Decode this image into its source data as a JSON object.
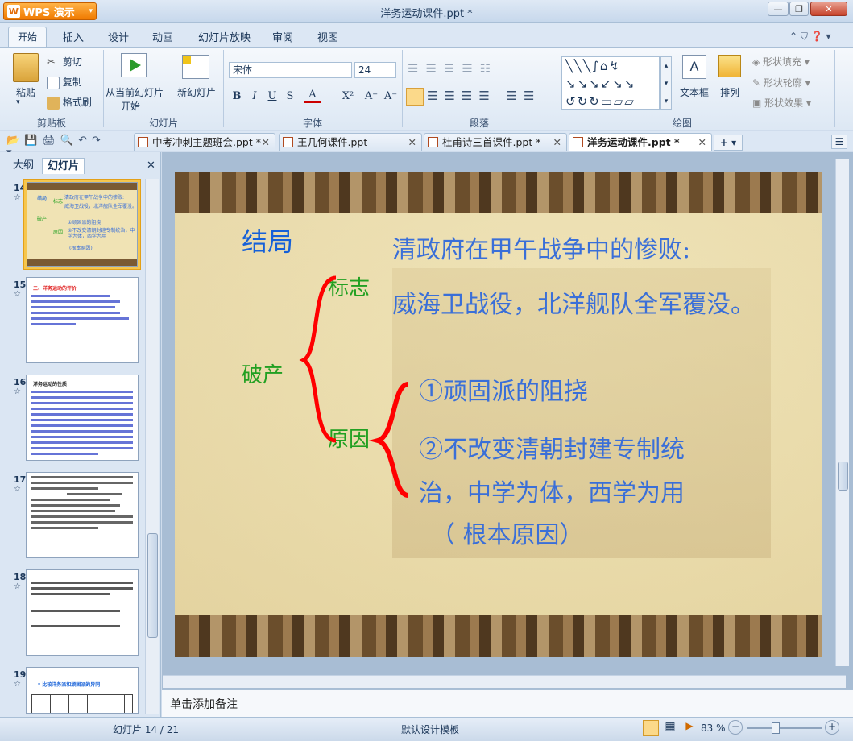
{
  "app": {
    "logo_text": "WPS 演示",
    "window_title": "洋务运动课件.ppt *"
  },
  "window_controls": {
    "minimize": "—",
    "restore": "❐",
    "close": "✕"
  },
  "ribbon_tabs": [
    "开始",
    "插入",
    "设计",
    "动画",
    "幻灯片放映",
    "审阅",
    "视图"
  ],
  "ribbon": {
    "clipboard": {
      "paste": "粘贴",
      "cut": "剪切",
      "copy": "复制",
      "format_painter": "格式刷",
      "group": "剪贴板"
    },
    "slides": {
      "from_current_line1": "从当前幻灯片",
      "from_current_line2": "开始",
      "new_slide": "新幻灯片",
      "group": "幻灯片"
    },
    "font": {
      "font_name": "宋体",
      "font_size": "24",
      "bold": "B",
      "italic": "I",
      "underline": "U",
      "strike": "S",
      "color": "A",
      "superscript": "X²",
      "grow": "A⁺",
      "shrink": "A⁻",
      "group": "字体"
    },
    "paragraph": {
      "group": "段落"
    },
    "drawing": {
      "textbox": "文本框",
      "arrange": "排列",
      "shape_fill": "形状填充",
      "shape_outline": "形状轮廓",
      "shape_effect": "形状效果",
      "group": "绘图"
    }
  },
  "doc_tabs": [
    {
      "label": "中考冲刺主题班会.ppt *"
    },
    {
      "label": "王几何课件.ppt"
    },
    {
      "label": "杜甫诗三首课件.ppt *"
    },
    {
      "label": "洋务运动课件.ppt *"
    }
  ],
  "left_pane": {
    "tab_outline": "大纲",
    "tab_slides": "幻灯片",
    "close": "✕",
    "slide_numbers": [
      "14",
      "15",
      "16",
      "17",
      "18",
      "19"
    ],
    "thumb14": {
      "line1": "清政府在甲午战争中的惨败:",
      "line2": "威海卫战役，北洋舰队全军覆没。",
      "label1": "结局",
      "label2": "标志",
      "label3": "破产",
      "label4": "原因",
      "item1": "①顽固派的阻挠",
      "item2": "②不改变清朝封建专制统治，中学为体，西学为用",
      "item3": "(根本原因)"
    },
    "thumb15": {
      "title": "二、洋务运动的评价"
    },
    "thumb16": {
      "title": "洋务运动的性质："
    },
    "thumb19": {
      "title": "* 比较洋务派和顽固派的异同"
    }
  },
  "slide": {
    "title": "结局",
    "label_sign": "标志",
    "label_bankrupt": "破产",
    "label_reason": "原因",
    "line1": "清政府在甲午战争中的惨败:",
    "line2": "威海卫战役，北洋舰队全军覆没。",
    "reason1": "①顽固派的阻挠",
    "reason2a": "②不改变清朝封建专制统",
    "reason2b": "治，中学为体，西学为用",
    "reason3": "（ 根本原因）"
  },
  "notes_placeholder": "单击添加备注",
  "status": {
    "slide_counter": "幻灯片 14 / 21",
    "template": "默认设计模板",
    "zoom": "83 %"
  },
  "colors": {
    "title_blue": "#1560d8",
    "label_green": "#22a022",
    "brace_red": "#ff0000",
    "body_blue": "#3a6fd8"
  }
}
